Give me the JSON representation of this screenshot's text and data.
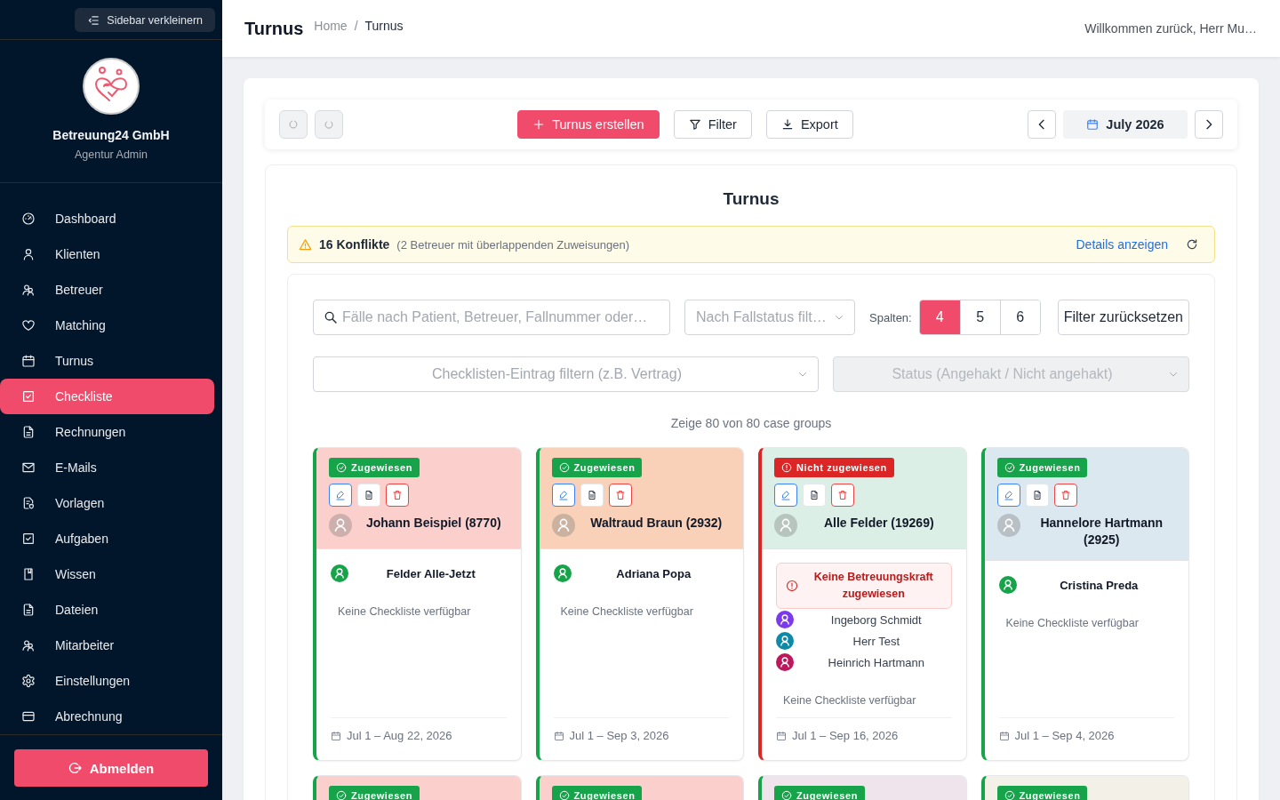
{
  "sidebar": {
    "collapse_button": "Sidebar verkleinern",
    "organization": "Betreuung24 GmbH",
    "role": "Agentur Admin",
    "nav": [
      {
        "label": "Dashboard",
        "selected": false
      },
      {
        "label": "Klienten",
        "selected": false
      },
      {
        "label": "Betreuer",
        "selected": false
      },
      {
        "label": "Matching",
        "selected": false
      },
      {
        "label": "Turnus",
        "selected": false
      },
      {
        "label": "Checkliste",
        "selected": true
      },
      {
        "label": "Rechnungen",
        "selected": false
      },
      {
        "label": "E-Mails",
        "selected": false
      },
      {
        "label": "Vorlagen",
        "selected": false
      },
      {
        "label": "Aufgaben",
        "selected": false
      },
      {
        "label": "Wissen",
        "selected": false
      },
      {
        "label": "Dateien",
        "selected": false
      },
      {
        "label": "Mitarbeiter",
        "selected": false
      },
      {
        "label": "Einstellungen",
        "selected": false
      },
      {
        "label": "Abrechnung",
        "selected": false
      }
    ],
    "logout_button": "Abmelden"
  },
  "header": {
    "title": "Turnus",
    "breadcrumb": [
      "Home",
      "Turnus"
    ],
    "breadcrumb_separator": "/",
    "welcome": "Willkommen zurück, Herr Mu…"
  },
  "toolbar": {
    "undo": {
      "disabled": true
    },
    "redo": {
      "disabled": true
    },
    "create_button": "Turnus erstellen",
    "filter_button": "Filter",
    "export_button": "Export",
    "month": "July 2026"
  },
  "panel": {
    "title": "Turnus",
    "conflicts": {
      "count": "16 Konflikte",
      "detail": "(2 Betreuer mit überlappenden Zuweisungen)",
      "link": "Details anzeigen"
    },
    "filters": {
      "search": {
        "placeholder": "Fälle nach Patient, Betreuer, Fallnummer oder…"
      },
      "case_status": {
        "placeholder": "Nach Fallstatus filt…"
      },
      "columns_label": "Spalten:",
      "columns": [
        {
          "label": "4",
          "selected": true
        },
        {
          "label": "5",
          "selected": false
        },
        {
          "label": "6",
          "selected": false
        }
      ],
      "reset_button": "Filter zurücksetzen",
      "checklist_entry": {
        "placeholder": "Checklisten-Eintrag filtern (z.B. Vertrag)"
      },
      "check_status": {
        "placeholder": "Status (Angehakt / Nicht angehakt)",
        "disabled": true
      }
    },
    "result_count": "Zeige 80 von 80 case groups",
    "cards": [
      {
        "status": {
          "kind": "assigned",
          "label": "Zugewiesen"
        },
        "color": "#fbd0cc",
        "patient": "Johann Beispiel (8770)",
        "caregivers": [
          {
            "name": "Felder Alle-Jetzt",
            "color": "#16a34a"
          }
        ],
        "checklist": "Keine Checkliste verfügbar",
        "dates": "Jul 1 – Aug 22, 2026"
      },
      {
        "status": {
          "kind": "assigned",
          "label": "Zugewiesen"
        },
        "color": "#f8d1b8",
        "patient": "Waltraud Braun (2932)",
        "caregivers": [
          {
            "name": "Adriana Popa",
            "color": "#16a34a"
          }
        ],
        "checklist": "Keine Checkliste verfügbar",
        "dates": "Jul 1 – Sep 3, 2026"
      },
      {
        "status": {
          "kind": "unassigned",
          "label": "Nicht zugewiesen"
        },
        "color": "#dcefe6",
        "patient": "Alle Felder (19269)",
        "warning": "Keine Betreuungskraft zugewiesen",
        "caregivers": [
          {
            "name": "Ingeborg Schmidt",
            "color": "#7c3aed"
          },
          {
            "name": "Herr Test",
            "color": "#0e8aa8"
          },
          {
            "name": "Heinrich Hartmann",
            "color": "#be185d"
          }
        ],
        "checklist": "Keine Checkliste verfügbar",
        "dates": "Jul 1 – Sep 16, 2026"
      },
      {
        "status": {
          "kind": "assigned",
          "label": "Zugewiesen"
        },
        "color": "#dce8f0",
        "patient": "Hannelore Hartmann (2925)",
        "caregivers": [
          {
            "name": "Cristina Preda",
            "color": "#16a34a"
          }
        ],
        "checklist": "Keine Checkliste verfügbar",
        "dates": "Jul 1 – Sep 4, 2026"
      },
      {
        "status": {
          "kind": "assigned",
          "label": "Zugewiesen"
        },
        "color": "#fbd0cc"
      },
      {
        "status": {
          "kind": "assigned",
          "label": "Zugewiesen"
        },
        "color": "#fbd0cc"
      },
      {
        "status": {
          "kind": "assigned",
          "label": "Zugewiesen"
        },
        "color": "#efe4ec"
      },
      {
        "status": {
          "kind": "assigned",
          "label": "Zugewiesen"
        },
        "color": "#f3f0e8"
      }
    ]
  }
}
